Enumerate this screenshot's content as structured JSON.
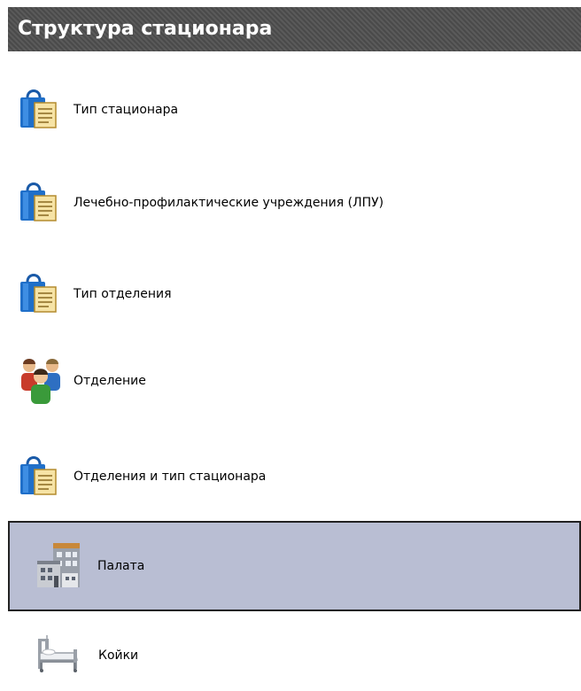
{
  "header": {
    "title": "Структура стационара"
  },
  "items": [
    {
      "label": "Тип стационара",
      "icon": "catalog-icon"
    },
    {
      "label": "Лечебно-профилактические учреждения (ЛПУ)",
      "icon": "catalog-icon"
    },
    {
      "label": "Тип отделения",
      "icon": "catalog-icon"
    },
    {
      "label": "Отделение",
      "icon": "people-icon"
    },
    {
      "label": "Отделения и тип стационара",
      "icon": "catalog-icon"
    },
    {
      "label": "Палата",
      "icon": "building-icon",
      "selected": true
    },
    {
      "label": "Койки",
      "icon": "bed-icon"
    }
  ],
  "colors": {
    "header_bg": "#4a4a4a",
    "header_text": "#ffffff",
    "selected_bg": "#b9bed3",
    "selected_border": "#222222"
  }
}
